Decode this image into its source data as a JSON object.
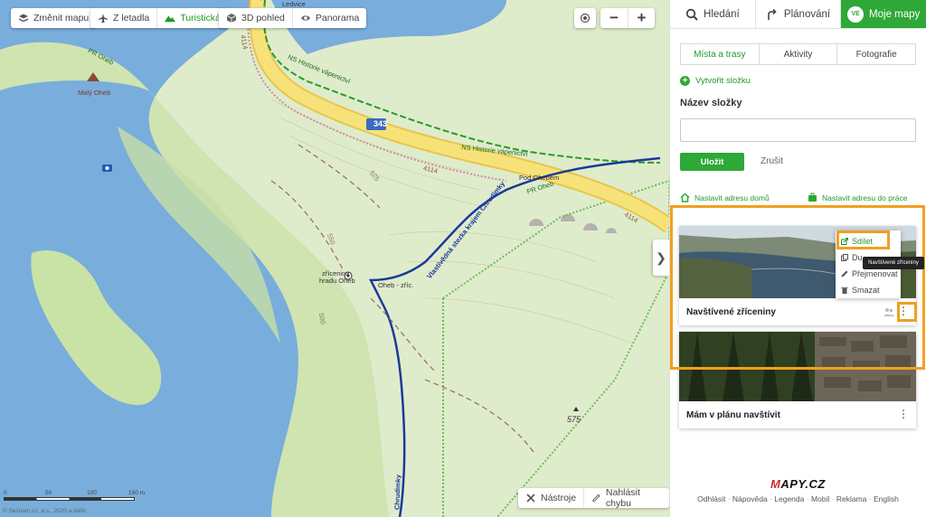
{
  "map_controls": {
    "change_map": "Změnit mapu",
    "from_plane": "Z letadla",
    "tourist": "Turistická",
    "view_3d": "3D pohled",
    "panorama": "Panorama",
    "zoom_out": "−",
    "zoom_in": "+",
    "collapse": "❯",
    "tools": "Nástroje",
    "report_error": "Nahlásit chybu"
  },
  "map_labels": {
    "road_number": "343",
    "trail_top": "NS Historie vápenictví",
    "trail_mid": "NS Historie vápenictví",
    "pod_ohebem": "Pod Ohebem",
    "pr_oheb_1": "PR Oheb",
    "pr_oheb_2": "PR Oheb",
    "maly_oheb": "Malý Oheb",
    "ruins_1": "zřícenina",
    "ruins_2": "hradu Oheb",
    "oheb_ruins_stop": "Oheb - zříc.",
    "chrudimka_path": "Vlastivědná stezka krajem Chrudimky",
    "chrudimka": "Chrudimky",
    "elev_575": "575",
    "elev_525": "525",
    "elev_550": "550",
    "elev_500": "500",
    "road_4114": "4114",
    "ledvice": "Ledvice",
    "road_4114b": "4114",
    "road_4114c": "4114"
  },
  "scale": {
    "ticks": [
      "0",
      "50",
      "100",
      "150 m"
    ]
  },
  "copyright": "© Seznam.cz, a.s., 2020 a další",
  "panel": {
    "nav": {
      "search": "Hledání",
      "planning": "Plánování",
      "avatar": "VE",
      "mine": "Moje mapy"
    },
    "tabs": [
      "Místa a trasy",
      "Aktivity",
      "Fotografie"
    ],
    "create_folder": "Vytvořit složku",
    "folder_label": "Název složky",
    "folder_value": "",
    "save": "Uložit",
    "cancel": "Zrušit",
    "set_home": "Nastavit adresu domů",
    "set_work": "Nastavit adresu do práce",
    "cards": [
      {
        "title": "Navštívené zříceniny"
      },
      {
        "title": "Mám v plánu navštívit"
      }
    ],
    "context_menu": {
      "share": "Sdílet",
      "duplicate": "Du",
      "rename": "Přejmenovat",
      "delete": "Smazat"
    },
    "tooltip": "Navštívené zříceniny",
    "logo_m": "M",
    "logo_rest": "APY.CZ",
    "footer": [
      "Odhlásit",
      "Nápověda",
      "Legenda",
      "Mobil",
      "Reklama",
      "English"
    ]
  },
  "colors": {
    "accent": "#2ea836",
    "highlight": "#f0a020",
    "water": "#6fa8d8",
    "land": "#dfeccb",
    "road": "#f7e27a"
  }
}
